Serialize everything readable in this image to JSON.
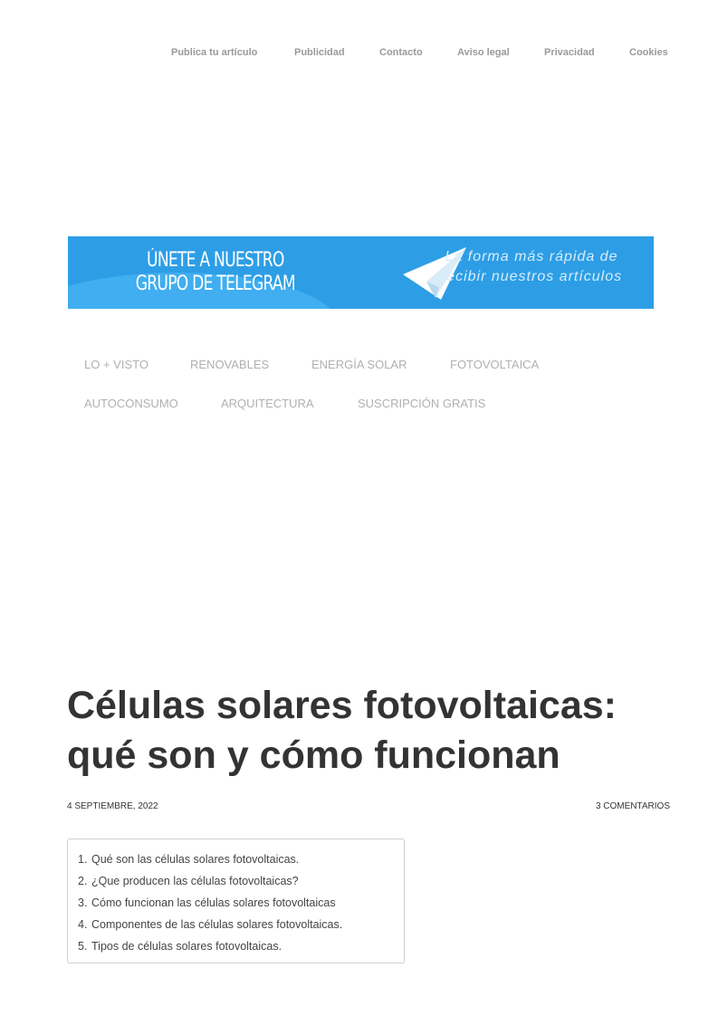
{
  "top_nav": {
    "items": [
      {
        "label": "Publica tu artículo"
      },
      {
        "label": "Publicidad"
      },
      {
        "label": "Contacto"
      },
      {
        "label": "Aviso legal"
      },
      {
        "label": "Privacidad"
      },
      {
        "label": "Cookies"
      }
    ]
  },
  "banner": {
    "line1": "ÚNETE A NUESTRO",
    "line2": "GRUPO DE TELEGRAM",
    "tagline1": "La forma más rápida de",
    "tagline2": "recibir nuestros artículos",
    "icon": "telegram-plane-icon",
    "bg_color": "#2d9ee6"
  },
  "main_nav": {
    "items": [
      {
        "label": "LO + VISTO"
      },
      {
        "label": "RENOVABLES"
      },
      {
        "label": "ENERGÍA SOLAR"
      },
      {
        "label": "FOTOVOLTAICA"
      },
      {
        "label": "AUTOCONSUMO"
      },
      {
        "label": "ARQUITECTURA"
      },
      {
        "label": "SUSCRIPCIÓN GRATIS"
      }
    ]
  },
  "article": {
    "title": "Células solares fotovoltaicas: qué son y cómo funcionan",
    "date": "4 SEPTIEMBRE, 2022",
    "comments": "3 COMENTARIOS"
  },
  "toc": {
    "items": [
      {
        "num": "1.",
        "label": "Qué son las células solares fotovoltaicas."
      },
      {
        "num": "2.",
        "label": "¿Que producen las células fotovoltaicas?"
      },
      {
        "num": "3.",
        "label": "Cómo funcionan las células solares fotovoltaicas"
      },
      {
        "num": "4.",
        "label": "Componentes de las células solares fotovoltaicas."
      },
      {
        "num": "5.",
        "label": "Tipos de células solares fotovoltaicas."
      }
    ]
  }
}
